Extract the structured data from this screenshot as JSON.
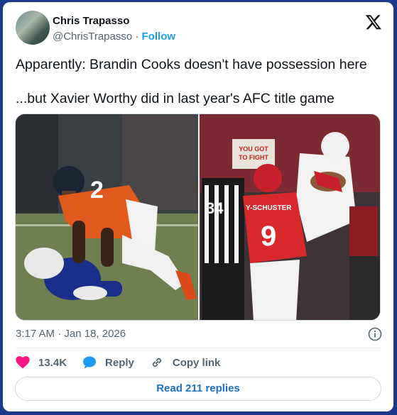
{
  "author": {
    "name": "Chris Trapasso",
    "handle": "@ChrisTrapasso",
    "separator": "·",
    "follow_label": "Follow"
  },
  "tweet": {
    "line1": "Apparently: Brandin Cooks doesn't have possession here",
    "line2": "...but Xavier Worthy did in last year's AFC title game"
  },
  "media": {
    "left_jersey_number": "2",
    "right_jersey_number": "9",
    "right_jersey_name": "Y-SCHUSTER",
    "ref_number": "34",
    "sign_text": [
      "YOU GOT",
      "TO FIGHT"
    ]
  },
  "timestamp": "3:17 AM · Jan 18, 2026",
  "actions": {
    "likes": "13.4K",
    "reply": "Reply",
    "copy_link": "Copy link"
  },
  "read_replies": "Read 211 replies",
  "colors": {
    "accent": "#1d9bf0",
    "heart": "#f91880",
    "reply_blue": "#1d6fc0",
    "page_bg": "#1a3a8a"
  },
  "icons": [
    "x-logo-icon",
    "info-icon",
    "heart-icon",
    "reply-bubble-icon",
    "link-icon"
  ]
}
